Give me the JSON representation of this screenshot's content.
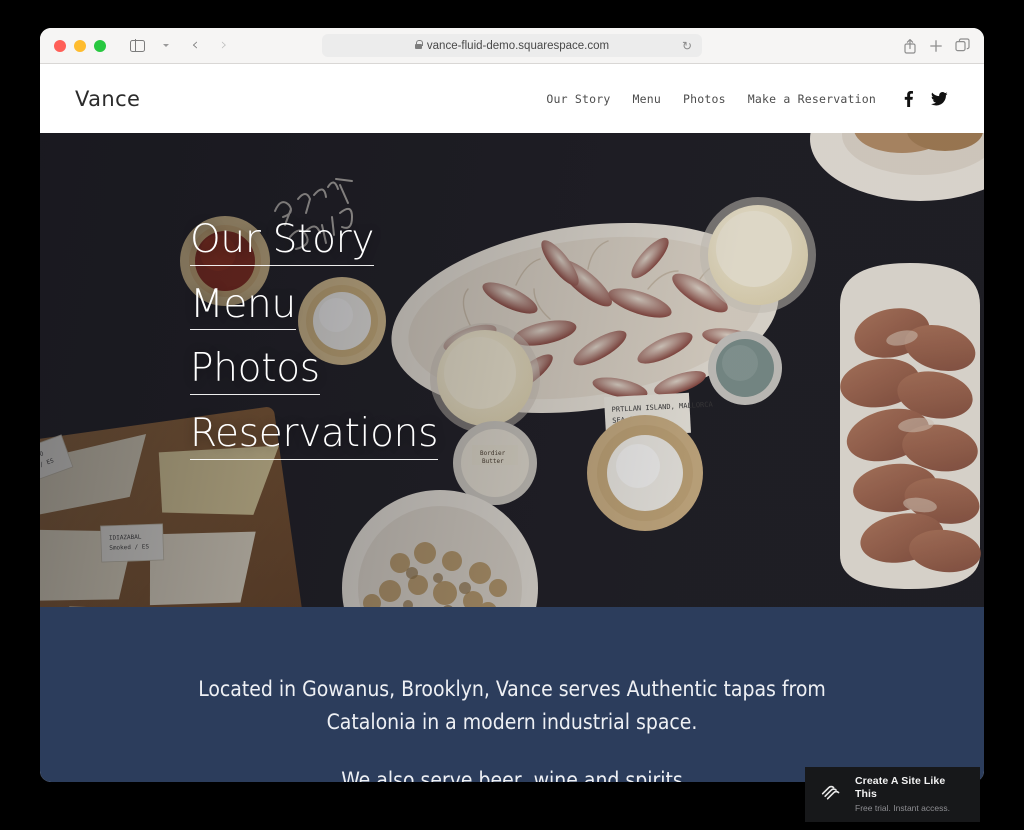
{
  "browser": {
    "url": "vance-fluid-demo.squarespace.com",
    "lock_icon": "lock-icon",
    "reload_icon": "reload-icon",
    "sidebar_icon": "sidebar-toggle-icon",
    "chevron_icon": "chevron-down-icon",
    "back_icon": "back-arrow-icon",
    "forward_icon": "forward-arrow-icon",
    "share_icon": "share-icon",
    "new_tab_icon": "plus-icon",
    "tabs_icon": "tab-overview-icon"
  },
  "site": {
    "logo": "Vance",
    "nav": [
      {
        "label": "Our Story"
      },
      {
        "label": "Menu"
      },
      {
        "label": "Photos"
      },
      {
        "label": "Make a Reservation"
      }
    ],
    "social": [
      {
        "name": "facebook-icon"
      },
      {
        "name": "twitter-icon"
      }
    ],
    "hero": {
      "links": [
        {
          "label": "Our Story"
        },
        {
          "label": "Menu"
        },
        {
          "label": "Photos"
        },
        {
          "label": "Reservations"
        }
      ],
      "photo_alt": "tapas spread: borlotti beans, butter, sea salt, cheese board, cured ham"
    },
    "intro": {
      "line1": "Located in Gowanus, Brooklyn, Vance serves Authentic tapas from",
      "line2": "Catalonia in a modern industrial space.",
      "line3": "We also serve beer, wine and spirits"
    }
  },
  "promo": {
    "title": "Create A Site Like This",
    "subtitle": "Free trial. Instant access.",
    "logo_icon": "squarespace-logo-icon"
  },
  "colors": {
    "blue_section": "#2c3d5c",
    "hero_dark": "#201f26",
    "promo_bg": "#17181a",
    "traffic_red": "#ff5f57",
    "traffic_yellow": "#febc2e",
    "traffic_green": "#28c840"
  }
}
